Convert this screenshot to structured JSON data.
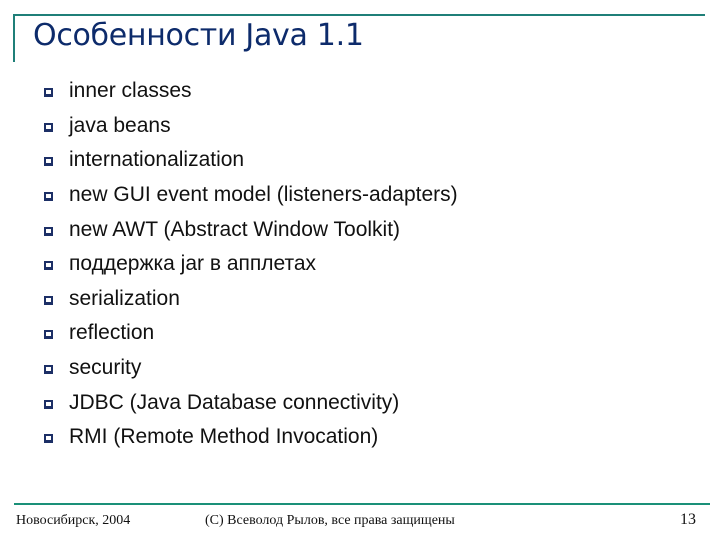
{
  "slide": {
    "title": "Особенности Java 1.1",
    "bullet_icon": "hollow-square-bullet",
    "bullets": [
      {
        "text": "inner classes"
      },
      {
        "text": "java beans"
      },
      {
        "text": "internationalization"
      },
      {
        "text": "new GUI event model (listeners-adapters)"
      },
      {
        "text": "new AWT (Abstract Window Toolkit)"
      },
      {
        "text": "поддержка jar в апплетах"
      },
      {
        "text": "serialization"
      },
      {
        "text": "reflection"
      },
      {
        "text": "security"
      },
      {
        "text": "JDBC (Java Database connectivity)"
      },
      {
        "text": "RMI (Remote Method Invocation)"
      }
    ]
  },
  "footer": {
    "left": "Новосибирск, 2004",
    "center": "(C) Всеволод Рылов, все права защищены",
    "page_number": "13"
  },
  "colors": {
    "title": "#0d2b6b",
    "rule": "#1f7f78",
    "bullet": "#1c2f66",
    "text": "#111111"
  }
}
